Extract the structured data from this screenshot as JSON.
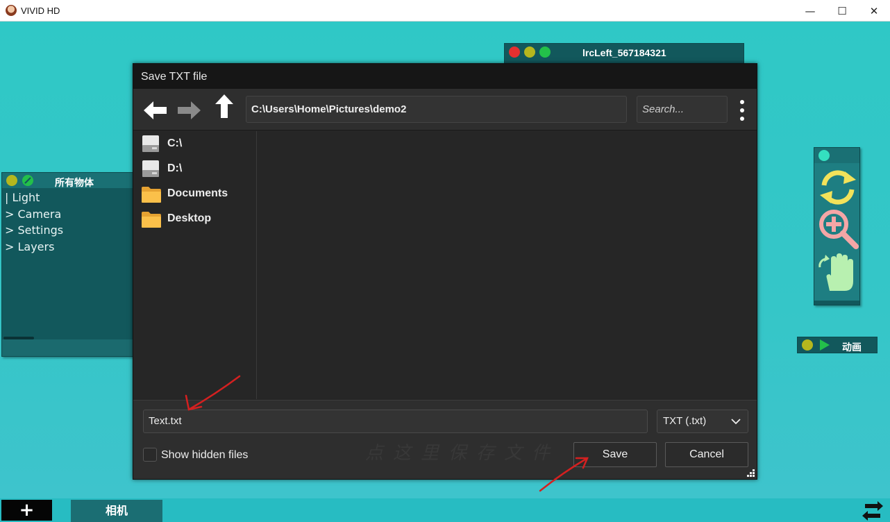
{
  "window": {
    "title": "VIVID HD",
    "minimize": "—",
    "maximize": "☐",
    "close": "✕"
  },
  "hierarchy_panel": {
    "title": "所有物体",
    "items": [
      "| Light",
      "> Camera",
      "> Settings",
      "> Layers"
    ]
  },
  "lrc_panel": {
    "title": "lrcLeft_567184321"
  },
  "tool_panel": {
    "icons": [
      "refresh-icon",
      "zoom-in-icon",
      "rotate-hand-icon"
    ]
  },
  "anim_panel": {
    "label": "动画"
  },
  "dialog": {
    "title": "Save TXT file",
    "path": "C:\\Users\\Home\\Pictures\\demo2",
    "search_placeholder": "Search...",
    "places": [
      "C:\\",
      "D:\\",
      "Documents",
      "Desktop"
    ],
    "filename": "Text.txt",
    "filetype": "TXT (.txt)",
    "show_hidden_label": "Show hidden files",
    "save_label": "Save",
    "cancel_label": "Cancel",
    "hint_text": "点这里保存文件"
  },
  "bottom_bar": {
    "add_label": "+",
    "camera_tab": "相机"
  },
  "colors": {
    "background": "#2ec7c4",
    "panel": "#12585c",
    "dialog": "#262626",
    "dot_red": "#e53030",
    "dot_yellow": "#b5b71e",
    "dot_green": "#23c04a",
    "annotation": "#d42020"
  }
}
